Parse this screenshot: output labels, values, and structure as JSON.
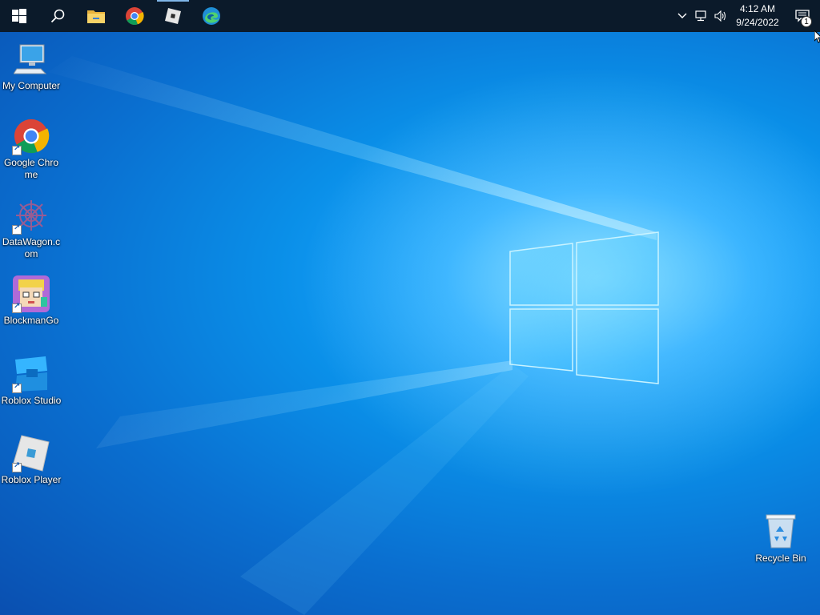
{
  "taskbar": {
    "buttons": [
      {
        "name": "start-button",
        "icon": "windows-logo-icon"
      },
      {
        "name": "search-button",
        "icon": "search-icon"
      },
      {
        "name": "file-explorer-button",
        "icon": "folder-icon"
      },
      {
        "name": "chrome-taskbar-button",
        "icon": "chrome-icon"
      },
      {
        "name": "roblox-taskbar-button",
        "icon": "roblox-icon",
        "active": true
      },
      {
        "name": "edge-taskbar-button",
        "icon": "edge-icon"
      }
    ],
    "tray": {
      "time": "4:12 AM",
      "date": "9/24/2022",
      "notification_count": "1"
    }
  },
  "desktop": {
    "icons": [
      {
        "label": "My Computer",
        "icon": "computer-icon"
      },
      {
        "label": "Google Chrome",
        "icon": "chrome-icon"
      },
      {
        "label": "DataWagon.com",
        "icon": "datawagon-icon"
      },
      {
        "label": "BlockmanGo",
        "icon": "blockmango-icon"
      },
      {
        "label": "Roblox Studio",
        "icon": "roblox-studio-icon"
      },
      {
        "label": "Roblox Player",
        "icon": "roblox-player-icon"
      },
      {
        "label": "Recycle Bin",
        "icon": "recycle-bin-icon"
      }
    ]
  },
  "colors": {
    "taskbar": "#0b1a2a",
    "wallpaper_accent": "#1aa6ff",
    "wallpaper_dark": "#0a4fb0"
  }
}
